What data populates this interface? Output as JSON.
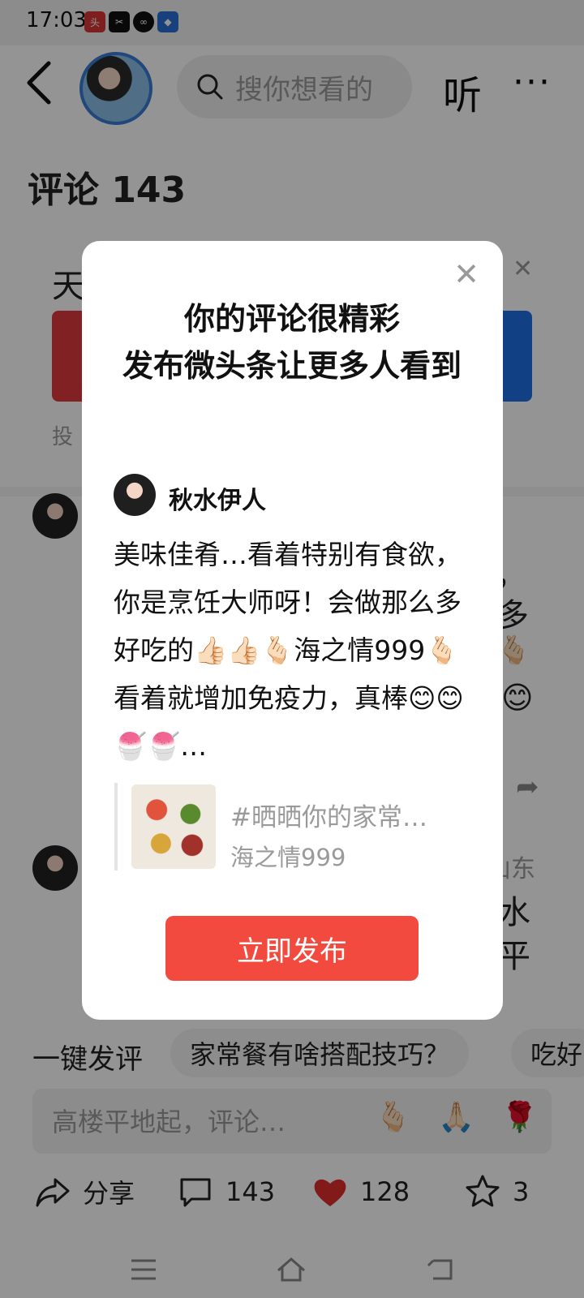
{
  "status_bar": {
    "time": "17:03",
    "icons": [
      "toutiao-app-icon",
      "capcut-app-icon",
      "link-app-icon",
      "box-app-icon"
    ]
  },
  "header": {
    "back_icon": "chevron-left-icon",
    "search_placeholder": "搜你想看的",
    "listen_label": "听",
    "more_label": "···"
  },
  "comments": {
    "title": "评论 143"
  },
  "background_card": {
    "title_char": "天",
    "small_char": "投"
  },
  "background_fragments": {
    "comma": "，",
    "duo": "多",
    "shandong": "山东",
    "shui": "水",
    "ping": "平"
  },
  "modal": {
    "title_line1": "你的评论很精彩",
    "title_line2": "发布微头条让更多人看到",
    "user_name": "秋水伊人",
    "comment_text": "美味佳肴…看着特别有食欲，你是烹饪大师呀！会做那么多好吃的👍🏻👍🏻🫰🏻海之情999🫰🏻看着就增加免疫力，真棒😊😊🍧🍧…",
    "ref_title": "#晒晒你的家常…",
    "ref_author": "海之情999",
    "publish_label": "立即发布"
  },
  "quick_reply": {
    "label": "一键发评",
    "chips": [
      "家常餐有啥搭配技巧？",
      "吃好"
    ]
  },
  "input_bar": {
    "placeholder": "高楼平地起，评论…",
    "emojis": [
      "🫰🏻",
      "🙏🏻",
      "🌹"
    ]
  },
  "actions": {
    "share": "分享",
    "comments": "143",
    "likes": "128",
    "favorites": "3"
  },
  "colors": {
    "publish_button": "#f34a3f",
    "like_heart": "#e02e2e",
    "overlay": "rgba(0,0,0,0.42)"
  }
}
